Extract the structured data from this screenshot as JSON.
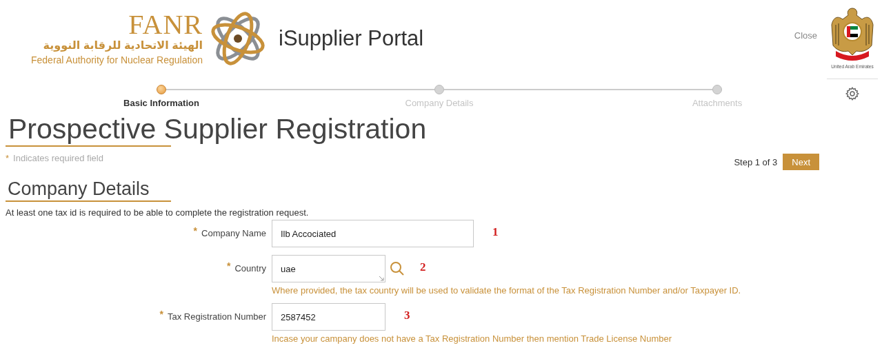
{
  "logo": {
    "acronym": "FANR",
    "arabic_name": "الهيئة الاتحادية للرقابة النووية",
    "english_name": "Federal Authority for Nuclear Regulation"
  },
  "portal_title": "iSupplier Portal",
  "close_link": "Close",
  "emblem_caption": "United Arab Emirates",
  "steps": [
    {
      "label": "Basic Information",
      "selected": true
    },
    {
      "label": "Company Details",
      "selected": false
    },
    {
      "label": "Attachments",
      "selected": false
    }
  ],
  "page_title": "Prospective Supplier Registration",
  "required_note": {
    "mark": "*",
    "text": "Indicates required field"
  },
  "step_counter": "Step 1 of 3",
  "next_button": "Next",
  "section_title": "Company Details",
  "section_note": "At least one tax id is required to be able to complete the registration request.",
  "fields": [
    {
      "kind": "long_text",
      "label": "Company Name",
      "required": true,
      "value": "Ilb Accociated",
      "annotation": "1"
    },
    {
      "kind": "lookup",
      "label": "Country",
      "required": true,
      "value": "uae",
      "annotation": "2",
      "hint": "Where provided, the tax country will be used to validate the format of the Tax Registration Number and/or Taxpayer ID."
    },
    {
      "kind": "short_text",
      "label": "Tax Registration Number",
      "required": true,
      "value": "2587452",
      "annotation": "3",
      "hint": "Incase your campany does not have a Tax Registration Number then mention Trade License Number"
    }
  ]
}
